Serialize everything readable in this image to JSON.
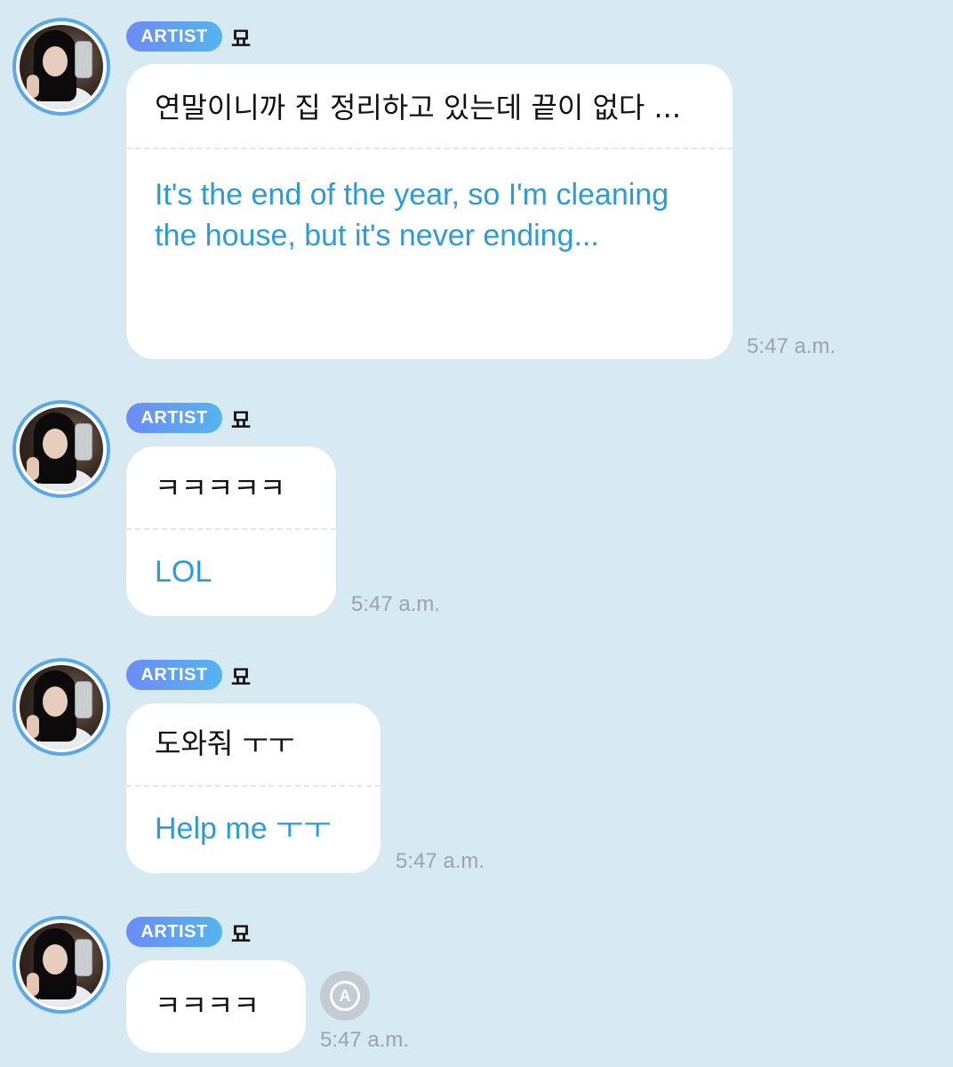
{
  "messages": [
    {
      "badge": "ARTIST",
      "name": "묘",
      "original": "연말이니까 집 정리하고 있는데 끝이 없다 ...",
      "translation": "It's the end of the year, so I'm cleaning the house, but it's never ending...",
      "time": "5:47 a.m."
    },
    {
      "badge": "ARTIST",
      "name": "묘",
      "original": "ㅋㅋㅋㅋㅋ",
      "translation": "LOL",
      "time": "5:47 a.m."
    },
    {
      "badge": "ARTIST",
      "name": "묘",
      "original": "도와줘 ㅜㅜ",
      "translation": "Help me ㅜㅜ",
      "time": "5:47 a.m."
    },
    {
      "badge": "ARTIST",
      "name": "묘",
      "original": "ㅋㅋㅋㅋ",
      "time": "5:47 a.m."
    }
  ],
  "translate_button": {
    "icon": "translate-icon",
    "glyph": "A"
  },
  "colors": {
    "background": "#d7eaf1",
    "translation_text": "#2b9cd8",
    "avatar_ring": "#5aa8ec"
  }
}
